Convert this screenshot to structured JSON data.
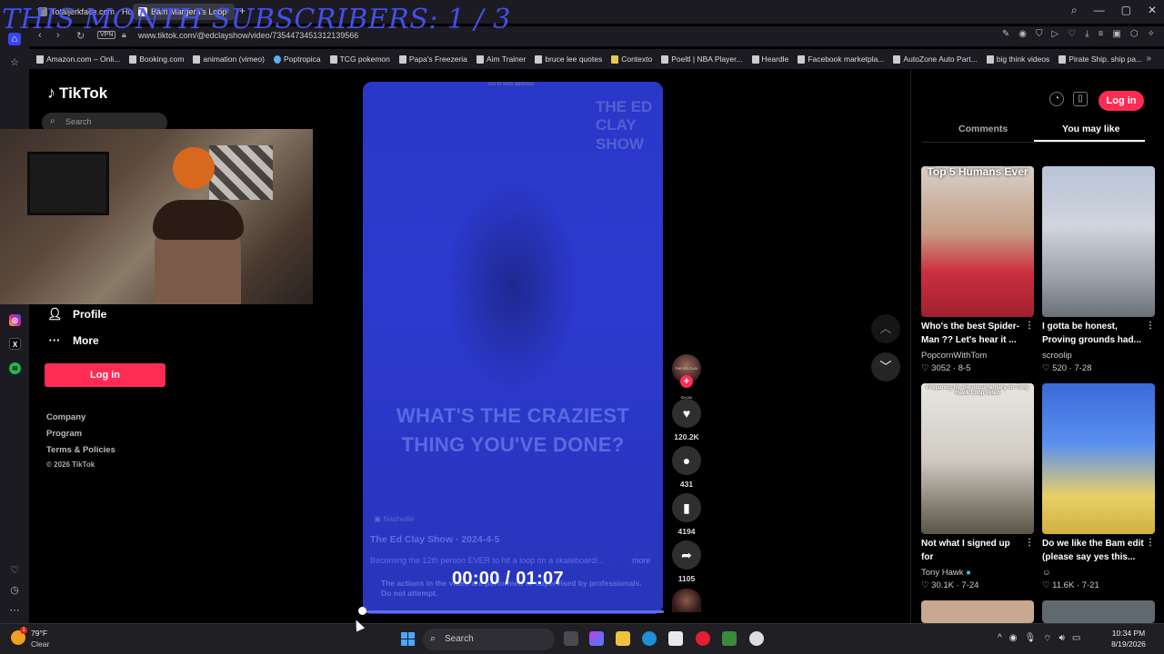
{
  "overlay": {
    "title": "THIS MONTH SUBSCRIBERS: 1 / 3"
  },
  "browser": {
    "tabs": [
      {
        "label": "Totaljerkface.com - Home"
      },
      {
        "label": "Bam Margera's Loop"
      }
    ],
    "url": "www.tiktok.com/@edclayshow/video/7354473451312139566",
    "vpn_label": "VPN",
    "bookmarks": [
      "Amazon.com – Onli...",
      "Booking.com",
      "animation (vimeo)",
      "Poptropica",
      "TCG pokemon",
      "Papa's Freezeria",
      "Aim Trainer",
      "bruce lee quotes",
      "Contexto",
      "Poeltl | NBA Player...",
      "Heardle",
      "Facebook marketpla...",
      "AutoZone Auto Part...",
      "big think videos",
      "Pirate Ship. ship pa..."
    ]
  },
  "tiktok": {
    "logo": "TikTok",
    "search_placeholder": "Search",
    "menu": [
      {
        "label": "Profile",
        "icon": "person-icon"
      },
      {
        "label": "More",
        "icon": "more-icon"
      }
    ],
    "login_label": "Log in",
    "footer": [
      "Company",
      "Program",
      "Terms & Policies"
    ],
    "copyright": "© 2026 TikTok"
  },
  "video": {
    "watermark": "THE ED CLAY SHOW",
    "question": "WHAT'S THE CRAZIEST THING YOU'VE DONE?",
    "location": "Nashville",
    "title": "The Ed Clay Show · 2024-4-5",
    "description": "Becoming the 12th person EVER to hit a loop on a skateboard!...",
    "more": "more",
    "warning": "The actions in the video are performed or supervised by professionals. Do not attempt.",
    "timer": "00:00 / 01:07",
    "tooltip": "Go to web address",
    "progress": 0,
    "avatar_label": "THE ED CLAY SHOW"
  },
  "actions": {
    "likes": "120.2K",
    "comments": "431",
    "saves": "4194",
    "shares": "1105"
  },
  "right_panel": {
    "login_label": "Log in",
    "tabs": [
      "Comments",
      "You may like"
    ],
    "active_tab": "You may like",
    "cards": [
      {
        "caption": "Top 5 Humans Ever",
        "title": "Who's the best Spider-Man ?? Let's hear it ...",
        "author": "PopcornWithTom",
        "stats": "3052 · 8-5"
      },
      {
        "caption": "",
        "title": "I gotta be honest, Proving grounds had...",
        "author": "scroolip",
        "stats": "520 · 7-28"
      },
      {
        "caption": "Preparing for the documentary on Tony Hawk Loop video",
        "title": "Not what I signed up for",
        "author": "Tony Hawk",
        "stats": "30.1K · 7-24"
      },
      {
        "caption": "",
        "title": "Do we like the Bam edit (please say yes this...",
        "author": "",
        "stats": "11.6K · 7-21"
      }
    ]
  },
  "taskbar": {
    "temp": "79°F",
    "condition": "Clear",
    "search": "Search",
    "time": "10:34 PM",
    "date": "8/19/2026"
  }
}
